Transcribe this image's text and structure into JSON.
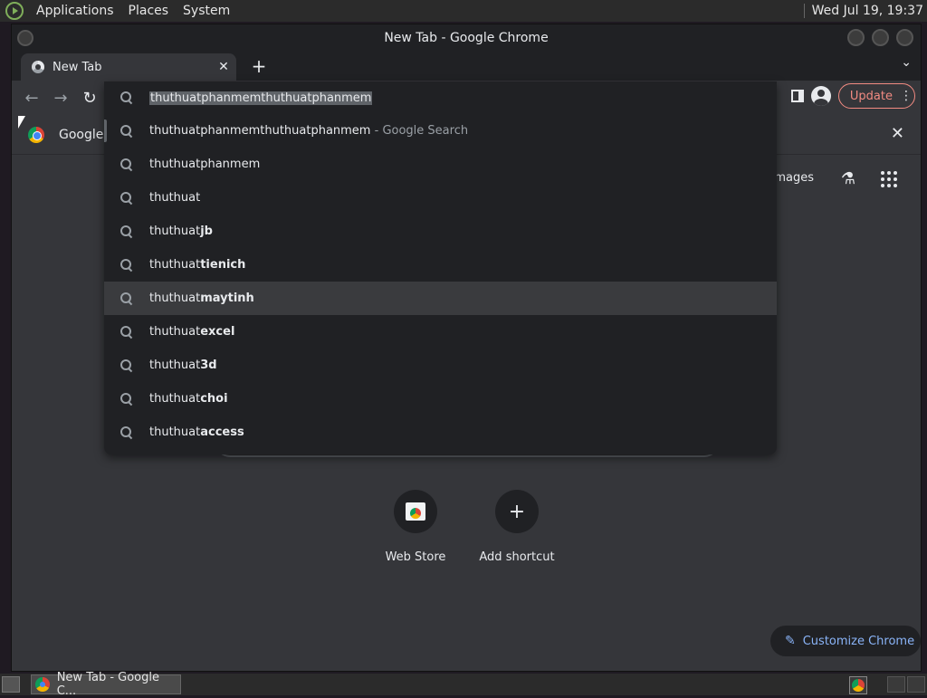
{
  "system_panel": {
    "menus": [
      "Applications",
      "Places",
      "System"
    ],
    "clock": "Wed Jul 19, 19:37"
  },
  "window": {
    "title": "New Tab - Google Chrome"
  },
  "tabs": [
    {
      "label": "New Tab",
      "active": true
    }
  ],
  "toolbar": {
    "update_label": "Update"
  },
  "infobar": {
    "text": "Google C"
  },
  "omnibox": {
    "input_value": "thuthuatphanmemthuthuatphanmem",
    "suggestions": [
      {
        "prefix": "thuthuatphanmemthuthuatphanmem",
        "bold": "",
        "suffix": " - Google Search",
        "state": "selected"
      },
      {
        "prefix": "thuthuatphanmem",
        "bold": "",
        "suffix": "",
        "state": "selected"
      },
      {
        "prefix": "thuthuat",
        "bold": "",
        "suffix": "",
        "state": "selected"
      },
      {
        "prefix": "thuthuat",
        "bold": "jb",
        "suffix": "",
        "state": "selected"
      },
      {
        "prefix": "thuthuat",
        "bold": "tienich",
        "suffix": "",
        "state": "normal"
      },
      {
        "prefix": "thuthuat",
        "bold": "maytinh",
        "suffix": "",
        "state": "hover"
      },
      {
        "prefix": "thuthuat",
        "bold": "excel",
        "suffix": "",
        "state": "normal"
      },
      {
        "prefix": "thuthuat",
        "bold": "3d",
        "suffix": "",
        "state": "normal"
      },
      {
        "prefix": "thuthuat",
        "bold": "choi",
        "suffix": "",
        "state": "normal"
      },
      {
        "prefix": "thuthuat",
        "bold": "access",
        "suffix": "",
        "state": "normal"
      }
    ]
  },
  "ntp": {
    "images_link": "Images",
    "shortcuts": [
      {
        "label": "Web Store",
        "icon": "webstore-icon"
      },
      {
        "label": "Add shortcut",
        "icon": "plus-icon"
      }
    ],
    "customize_label": "Customize Chrome"
  },
  "taskbar": {
    "item_label": "New Tab - Google C..."
  },
  "colors": {
    "accent_update": "#f28b82",
    "accent_link": "#8ab4f8",
    "bg_dark": "#202124",
    "bg_surface": "#35363a"
  }
}
